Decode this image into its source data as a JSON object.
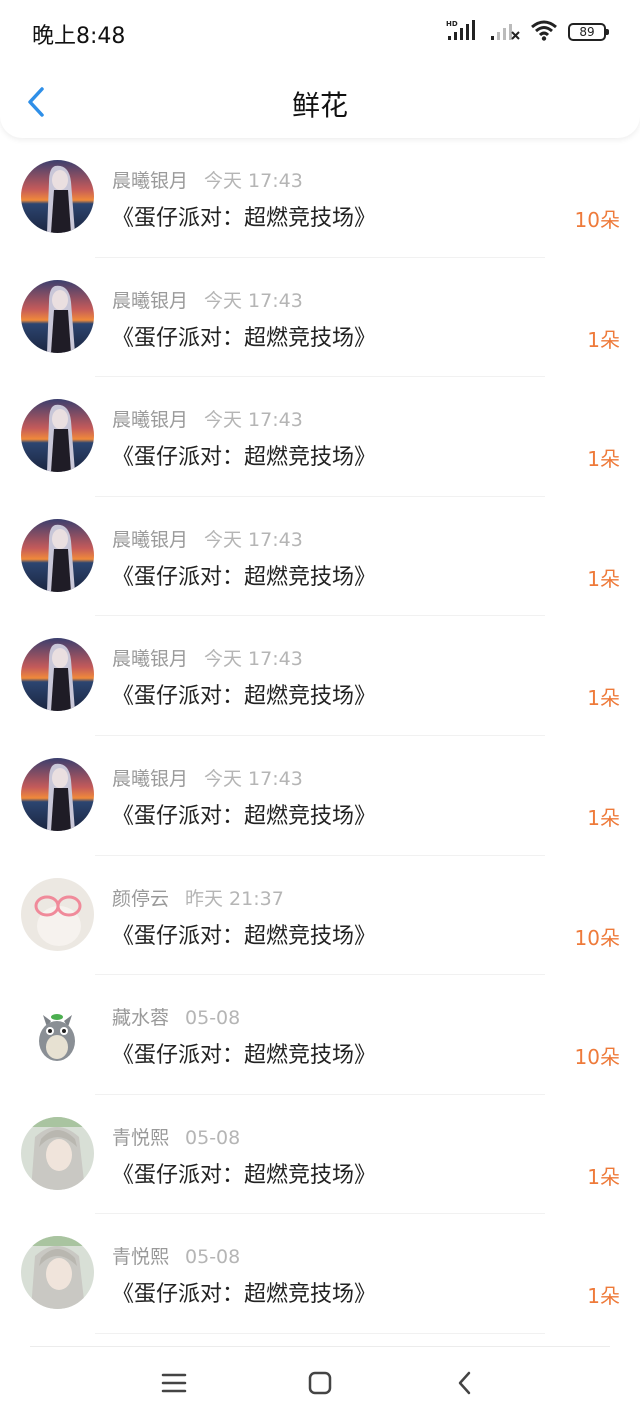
{
  "status_bar": {
    "time": "晚上8:48",
    "battery": "89",
    "icons": [
      "hd-signal-icon",
      "signal-icon",
      "wifi-icon",
      "battery-icon"
    ]
  },
  "header": {
    "title": "鲜花",
    "back_icon": "chevron-left-icon"
  },
  "colors": {
    "accent": "#2f8fe8",
    "count": "#ee7a3a"
  },
  "items": [
    {
      "name": "晨曦银月",
      "time": "今天 17:43",
      "gift": "《蛋仔派对：超燃竞技场》",
      "count": "10朵",
      "avatar": "sunset"
    },
    {
      "name": "晨曦银月",
      "time": "今天 17:43",
      "gift": "《蛋仔派对：超燃竞技场》",
      "count": "1朵",
      "avatar": "sunset"
    },
    {
      "name": "晨曦银月",
      "time": "今天 17:43",
      "gift": "《蛋仔派对：超燃竞技场》",
      "count": "1朵",
      "avatar": "sunset"
    },
    {
      "name": "晨曦银月",
      "time": "今天 17:43",
      "gift": "《蛋仔派对：超燃竞技场》",
      "count": "1朵",
      "avatar": "sunset"
    },
    {
      "name": "晨曦银月",
      "time": "今天 17:43",
      "gift": "《蛋仔派对：超燃竞技场》",
      "count": "1朵",
      "avatar": "sunset"
    },
    {
      "name": "晨曦银月",
      "time": "今天 17:43",
      "gift": "《蛋仔派对：超燃竞技场》",
      "count": "1朵",
      "avatar": "sunset"
    },
    {
      "name": "颜停云",
      "time": "昨天 21:37",
      "gift": "《蛋仔派对：超燃竞技场》",
      "count": "10朵",
      "avatar": "pink-glasses"
    },
    {
      "name": "藏水蓉",
      "time": "05-08",
      "gift": "《蛋仔派对：超燃竞技场》",
      "count": "10朵",
      "avatar": "totoro"
    },
    {
      "name": "青悦熙",
      "time": "05-08",
      "gift": "《蛋仔派对：超燃竞技场》",
      "count": "1朵",
      "avatar": "anime-girl"
    },
    {
      "name": "青悦熙",
      "time": "05-08",
      "gift": "《蛋仔派对：超燃竞技场》",
      "count": "1朵",
      "avatar": "anime-girl"
    }
  ],
  "system_nav": [
    "menu-icon",
    "home-icon",
    "back-icon"
  ]
}
